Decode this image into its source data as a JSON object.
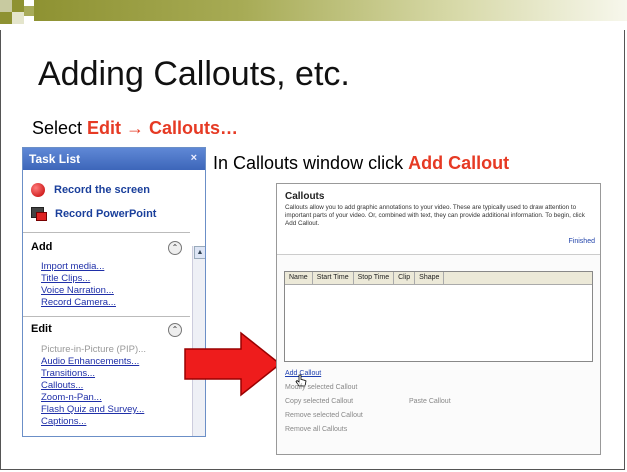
{
  "slide": {
    "title": "Adding Callouts, etc.",
    "instruction_prefix": "Select ",
    "menu_path": "Edit → Callouts…",
    "callout_instruction_prefix": "In Callouts window click ",
    "callout_instruction_action": "Add Callout"
  },
  "task_list": {
    "header": "Task List",
    "close_glyph": "×",
    "record_screen": "Record the screen",
    "record_powerpoint": "Record PowerPoint",
    "add_section": {
      "heading": "Add",
      "items": [
        "Import media...",
        "Title Clips...",
        "Voice Narration...",
        "Record Camera..."
      ]
    },
    "edit_section": {
      "heading": "Edit",
      "disabled_item": "Picture-in-Picture (PIP)...",
      "items": [
        "Audio Enhancements...",
        "Transitions...",
        "Callouts...",
        "Zoom-n-Pan...",
        "Flash Quiz and Survey...",
        "Captions..."
      ]
    },
    "chevron_glyph": "⌃"
  },
  "callouts_window": {
    "title": "Callouts",
    "description": "Callouts allow you to add graphic annotations to your video. These are typically used to draw attention to important parts of your video. Or, combined with text, they can provide additional information. To begin, click Add Callout.",
    "finished": "Finished",
    "columns": [
      "Name",
      "Start Time",
      "Stop Time",
      "Clip",
      "Shape"
    ],
    "actions": {
      "add": "Add Callout",
      "modify": "Modify selected Callout",
      "copy": "Copy selected Callout",
      "paste": "Paste Callout",
      "remove": "Remove selected Callout",
      "remove_all": "Remove all Callouts"
    }
  },
  "colors": {
    "highlight": "#e63a24",
    "olive": "#8e9232",
    "task_header": "#3d66b9"
  }
}
